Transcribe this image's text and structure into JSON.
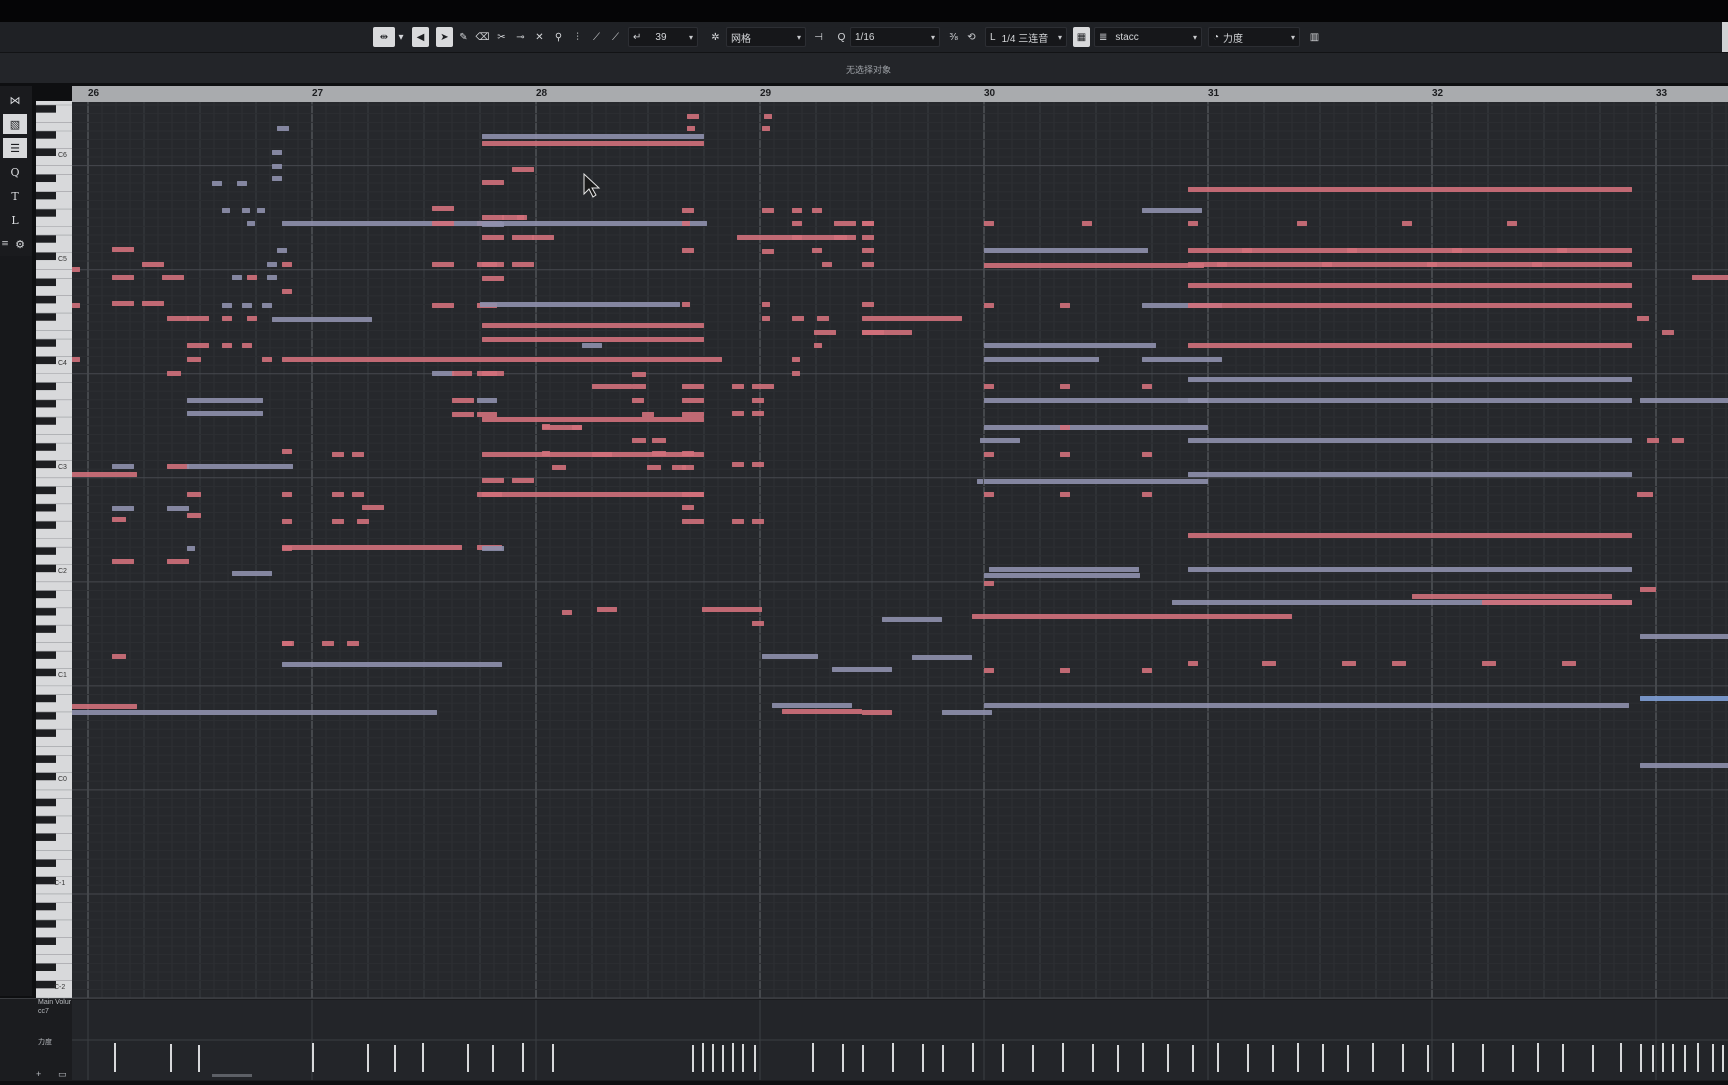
{
  "toolbar": {
    "quantize_count": "39",
    "grid_type": "网格",
    "quantize": "1/16",
    "length_quantize": "1/4 三连音",
    "articulation": "stacc",
    "controller": "力度"
  },
  "status_text": "无选择对象",
  "ruler": {
    "bars": [
      "26",
      "27",
      "28",
      "29",
      "30",
      "31",
      "32",
      "33"
    ]
  },
  "keyboard": {
    "octave_labels": [
      "C6",
      "C5",
      "C4",
      "C3",
      "C2",
      "C1",
      "C0",
      "C-1",
      "C-2"
    ]
  },
  "controller_lane": {
    "label_main": "Main Volur",
    "label_cc": "cc7",
    "label_velocity": "力度"
  },
  "colors": {
    "note_red": "#d2707b",
    "note_blue": "#8f90ad",
    "note_light_blue": "#7f9ed6",
    "grid_bg": "#26282c",
    "ruler_bg": "#a9abae"
  },
  "icons": [
    "object-select-icon",
    "mute-icon",
    "arrow-tool-icon",
    "pencil-icon",
    "eraser-icon",
    "split-icon",
    "glue-icon",
    "mute-tool-icon",
    "zoom-icon",
    "drumstick-icon",
    "line-icon",
    "snap-icon",
    "quantize-icon",
    "step-input-icon",
    "midi-input-icon"
  ]
}
